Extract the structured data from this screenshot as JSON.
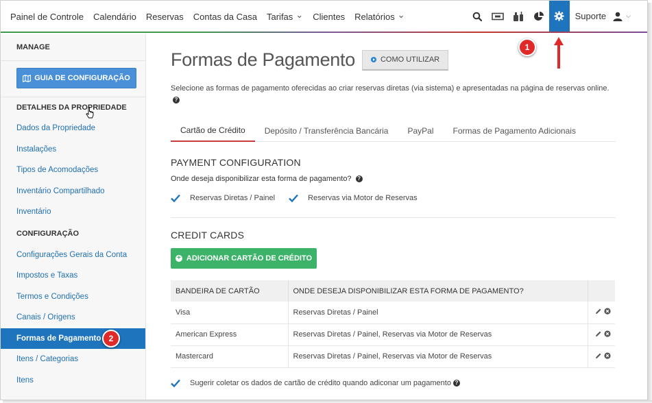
{
  "topnav": {
    "items": [
      {
        "label": "Painel de Controle",
        "caret": false
      },
      {
        "label": "Calendário",
        "caret": false
      },
      {
        "label": "Reservas",
        "caret": false
      },
      {
        "label": "Contas da Casa",
        "caret": false
      },
      {
        "label": "Tarifas",
        "caret": true
      },
      {
        "label": "Clientes",
        "caret": false
      },
      {
        "label": "Relatórios",
        "caret": true
      }
    ],
    "icons": [
      "search-icon",
      "ticket-icon",
      "housekeeping-icon",
      "pie-chart-icon",
      "gear-icon"
    ],
    "support_label": "Suporte",
    "user_icon": "user-icon",
    "active_color": "#1f74be"
  },
  "sidebar": {
    "manage_label": "MANAGE",
    "guide_button": "GUIA DE CONFIGURAÇÃO",
    "section1": "DETALHES DA PROPRIEDADE",
    "links1": [
      "Dados da Propriedade",
      "Instalações",
      "Tipos de Acomodações",
      "Inventário Compartilhado",
      "Inventário"
    ],
    "section2": "CONFIGURAÇÃO",
    "links2": [
      "Configurações Gerais da Conta",
      "Impostos e Taxas",
      "Termos e Condições",
      "Canais / Origens",
      "Formas de Pagamento",
      "Itens / Categorias",
      "Itens"
    ],
    "active_link": "Formas de Pagamento"
  },
  "main": {
    "title": "Formas de Pagamento",
    "howto_button": "COMO UTILIZAR",
    "description": "Selecione as formas de pagamento oferecidas ao criar reservas diretas (via sistema) e apresentadas na página de reservas online.",
    "tabs": [
      "Cartão de Crédito",
      "Depósito / Transferência Bancária",
      "PayPal",
      "Formas de Pagamento Adicionais"
    ],
    "active_tab": "Cartão de Crédito",
    "payment_config": {
      "title": "PAYMENT CONFIGURATION",
      "question": "Onde deseja disponibilizar esta forma de pagamento?",
      "options": [
        "Reservas Diretas / Painel",
        "Reservas via Motor de Reservas"
      ]
    },
    "credit_cards": {
      "title": "CREDIT CARDS",
      "add_button": "ADICIONAR CARTÃO DE CRÉDITO",
      "columns": [
        "BANDEIRA DE CARTÃO",
        "ONDE DESEJA DISPONIBILIZAR ESTA FORMA DE PAGAMENTO?",
        ""
      ],
      "rows": [
        {
          "brand": "Visa",
          "where": "Reservas Diretas / Painel"
        },
        {
          "brand": "American Express",
          "where": "Reservas Diretas / Painel, Reservas via Motor de Reservas"
        },
        {
          "brand": "Mastercard",
          "where": "Reservas Diretas / Painel, Reservas via Motor de Reservas"
        }
      ],
      "suggest": "Sugerir coletar os dados de cartão de crédito quando adiconar um pagamento"
    }
  },
  "annotations": {
    "badge1": "1",
    "badge2": "2",
    "badge_color": "#e02a2a"
  }
}
